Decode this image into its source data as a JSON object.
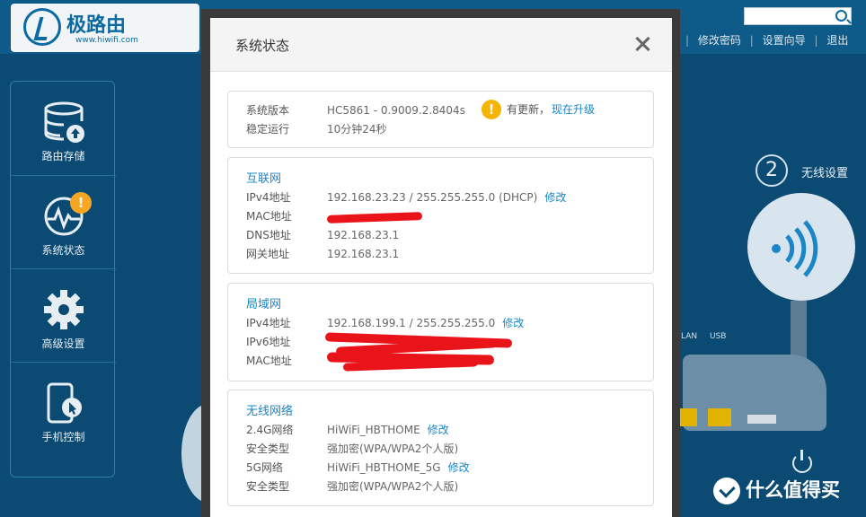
{
  "app": {
    "logo_text": "极路由",
    "logo_url": "www.hiwifi.com",
    "search_placeholder": "",
    "top_links": [
      "修改密码",
      "设置向导",
      "退出"
    ]
  },
  "sidebar": {
    "items": [
      {
        "label": "路由存储",
        "icon": "storage-icon"
      },
      {
        "label": "系统状态",
        "icon": "pulse-icon",
        "badge": "!"
      },
      {
        "label": "高级设置",
        "icon": "gear-icon"
      },
      {
        "label": "手机控制",
        "icon": "phone-icon"
      }
    ]
  },
  "background": {
    "step_number": "2",
    "step_label": "无线设置",
    "port_labels": [
      "LAN",
      "USB"
    ],
    "watermark": "什么值得买"
  },
  "modal": {
    "title": "系统状态",
    "system": {
      "version_label": "系统版本",
      "version_value": "HC5861 - 0.9009.2.8404s",
      "update_text": "有更新，",
      "update_link": "现在升级",
      "uptime_label": "稳定运行",
      "uptime_value": "10分钟24秒"
    },
    "internet": {
      "title": "互联网",
      "ipv4_label": "IPv4地址",
      "ipv4_value": "192.168.23.23 / 255.255.255.0 (DHCP)",
      "ipv4_link": "修改",
      "mac_label": "MAC地址",
      "dns_label": "DNS地址",
      "dns_value": "192.168.23.1",
      "gateway_label": "网关地址",
      "gateway_value": "192.168.23.1"
    },
    "lan": {
      "title": "局域网",
      "ipv4_label": "IPv4地址",
      "ipv4_value": "192.168.199.1 / 255.255.255.0",
      "ipv4_link": "修改",
      "ipv6_label": "IPv6地址",
      "mac_label": "MAC地址"
    },
    "wireless": {
      "title": "无线网络",
      "g24_label": "2.4G网络",
      "g24_value": "HiWiFi_HBTHOME",
      "g24_link": "修改",
      "sec1_label": "安全类型",
      "sec1_value": "强加密(WPA/WPA2个人版)",
      "g5_label": "5G网络",
      "g5_value": "HiWiFi_HBTHOME_5G",
      "g5_link": "修改",
      "sec2_label": "安全类型",
      "sec2_value": "强加密(WPA/WPA2个人版)"
    }
  },
  "colors": {
    "link": "#1a86c8",
    "redaction": "#e8141a",
    "background": "#0b4a72"
  }
}
